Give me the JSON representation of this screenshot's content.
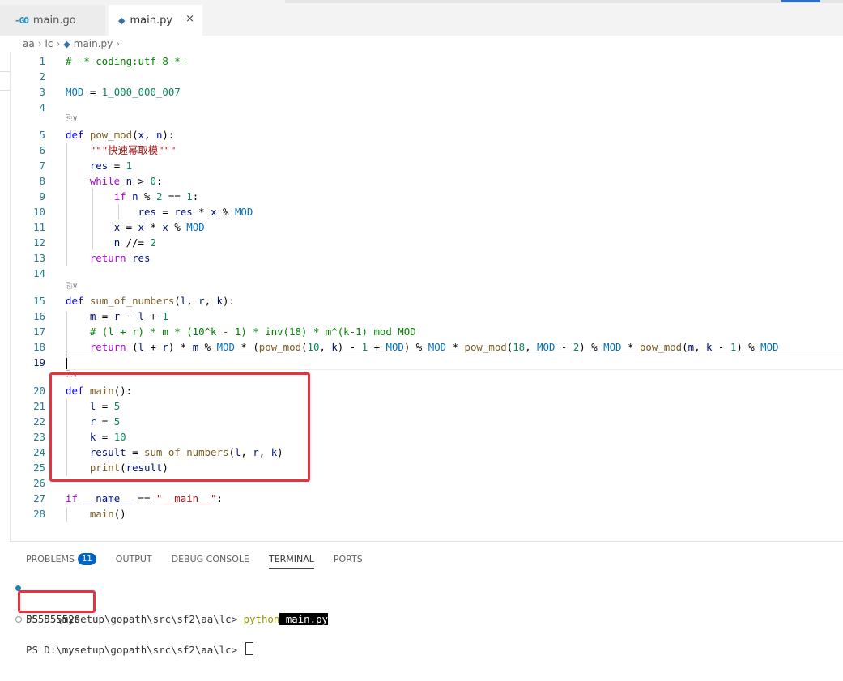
{
  "tabs": [
    {
      "label": "main.go",
      "icon": "go-icon",
      "active": false
    },
    {
      "label": "main.py",
      "icon": "python-icon",
      "active": true,
      "close": "×"
    }
  ],
  "breadcrumb": [
    "aa",
    "lc",
    "main.py"
  ],
  "editor": {
    "code_lens": "⎘∨",
    "lines": [
      {
        "n": "1"
      },
      {
        "n": "2"
      },
      {
        "n": "3"
      },
      {
        "n": "4"
      },
      {
        "n": "5"
      },
      {
        "n": "6"
      },
      {
        "n": "7"
      },
      {
        "n": "8"
      },
      {
        "n": "9"
      },
      {
        "n": "10"
      },
      {
        "n": "11"
      },
      {
        "n": "12"
      },
      {
        "n": "13"
      },
      {
        "n": "14"
      },
      {
        "n": "15"
      },
      {
        "n": "16"
      },
      {
        "n": "17"
      },
      {
        "n": "18"
      },
      {
        "n": "19"
      },
      {
        "n": "20"
      },
      {
        "n": "21"
      },
      {
        "n": "22"
      },
      {
        "n": "23"
      },
      {
        "n": "24"
      },
      {
        "n": "25"
      },
      {
        "n": "26"
      },
      {
        "n": "27"
      },
      {
        "n": "28"
      }
    ],
    "current_line": "19"
  },
  "panel": {
    "tabs": [
      {
        "label": "PROBLEMS",
        "badge": "11"
      },
      {
        "label": "OUTPUT"
      },
      {
        "label": "DEBUG CONSOLE"
      },
      {
        "label": "TERMINAL",
        "active": true
      },
      {
        "label": "PORTS"
      }
    ],
    "terminal": {
      "prompt1": "PS D:\\mysetup\\gopath\\src\\sf2\\aa\\lc> ",
      "cmd": "python",
      "arg": " main.py",
      "output": "555555520",
      "prompt2": "PS D:\\mysetup\\gopath\\src\\sf2\\aa\\lc> "
    }
  },
  "colors": {
    "keyword": "#af00db",
    "def": "#0000ff",
    "function": "#795e26",
    "number": "#098658",
    "string": "#a31515",
    "comment": "#008000",
    "constant": "#0070c1",
    "highlight_box": "#e5343d"
  }
}
